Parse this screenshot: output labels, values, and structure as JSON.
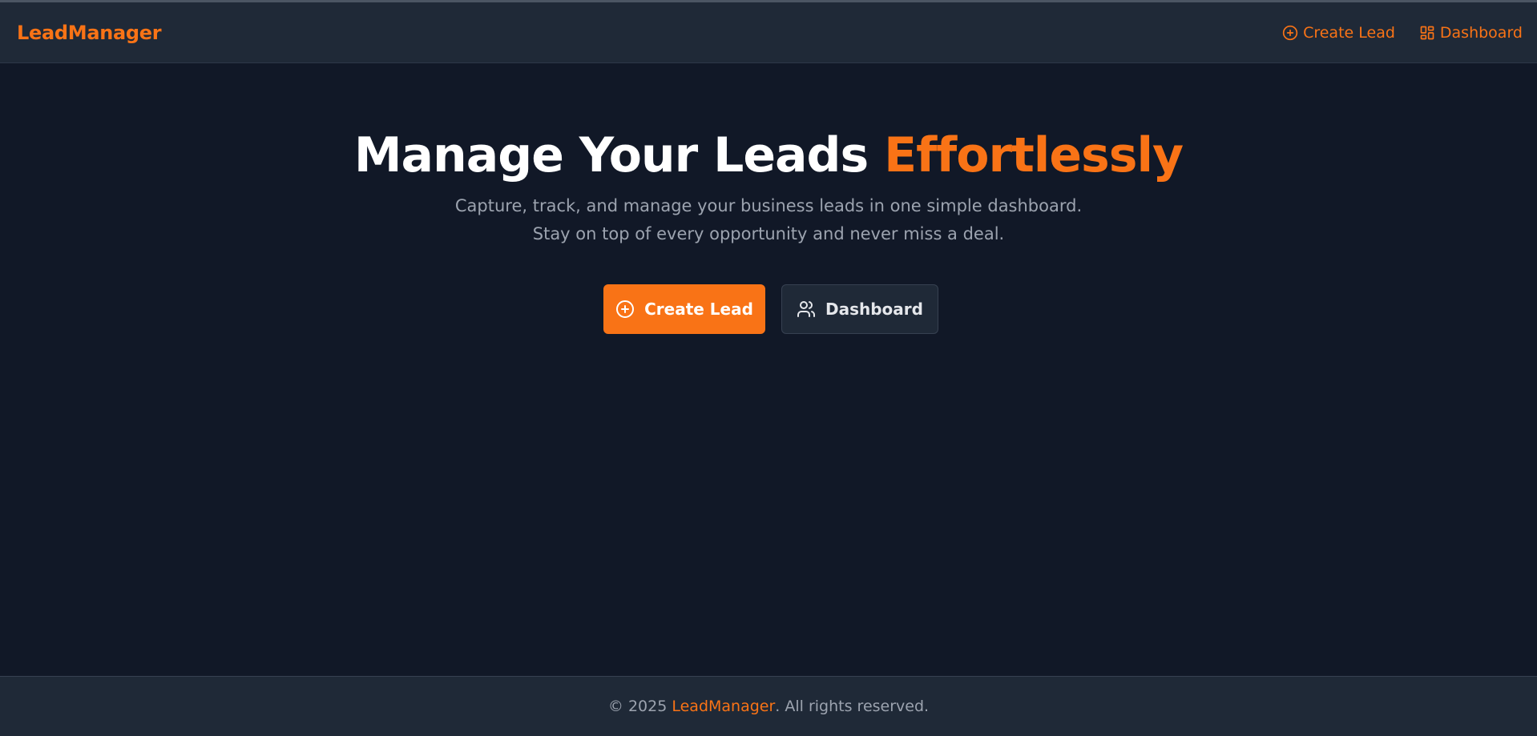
{
  "colors": {
    "accent": "#f97316",
    "background": "#111827",
    "surface": "#1f2937"
  },
  "navbar": {
    "brand": "LeadManager",
    "links": [
      {
        "label": "Create Lead",
        "icon": "plus-circle-icon"
      },
      {
        "label": "Dashboard",
        "icon": "dashboard-grid-icon"
      }
    ]
  },
  "hero": {
    "title_main": "Manage Your Leads ",
    "title_accent": "Effortlessly",
    "subtitle": "Capture, track, and manage your business leads in one simple dashboard. Stay on top of every opportunity and never miss a deal.",
    "primary_button": {
      "label": "Create Lead",
      "icon": "plus-circle-icon"
    },
    "secondary_button": {
      "label": "Dashboard",
      "icon": "users-icon"
    }
  },
  "footer": {
    "prefix": "© 2025 ",
    "brand": "LeadManager",
    "suffix": ". All rights reserved."
  }
}
